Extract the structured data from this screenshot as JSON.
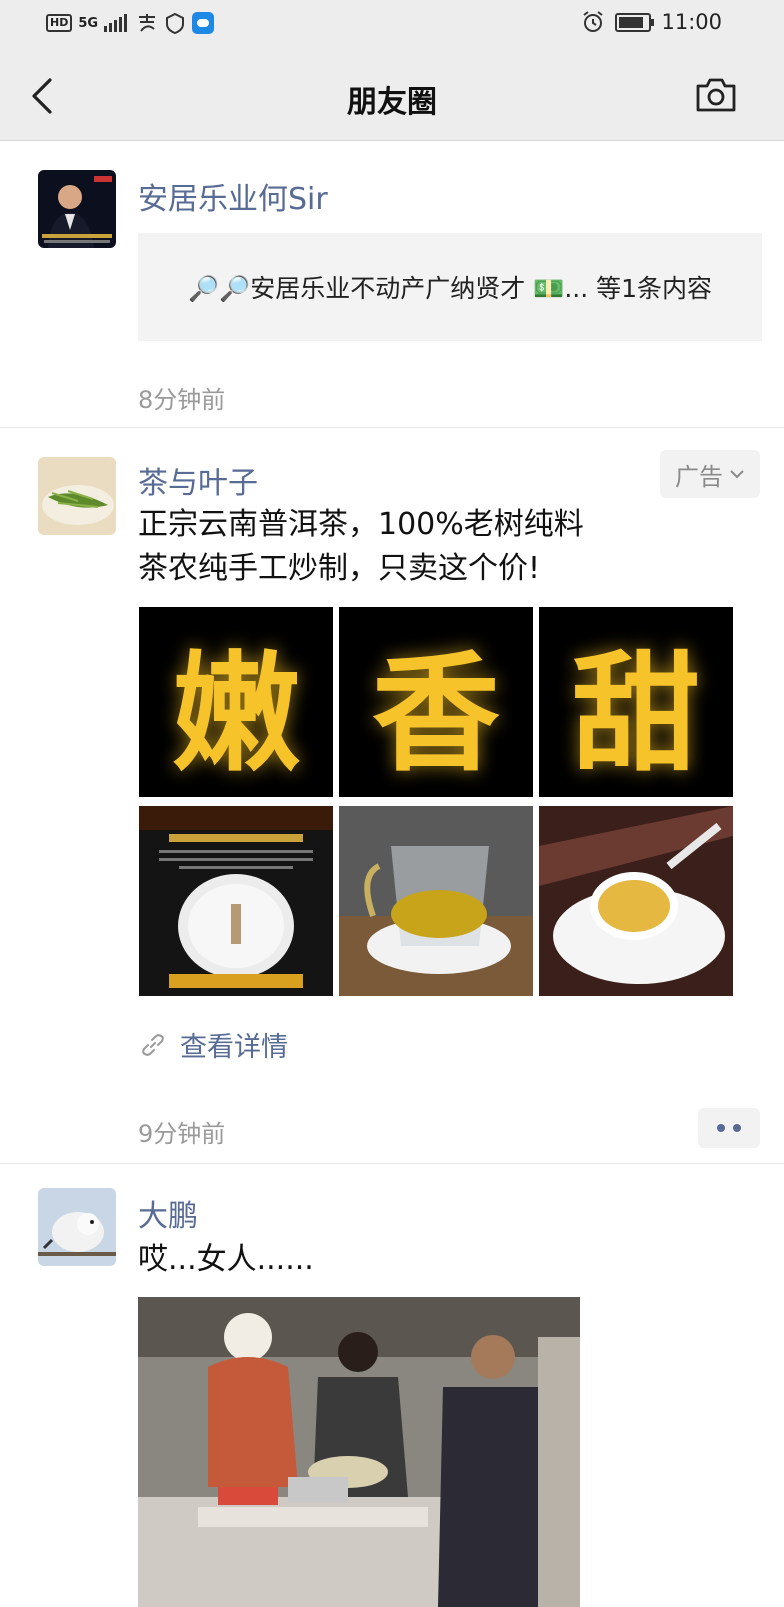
{
  "status_bar": {
    "network_badge": "HD",
    "network_type": "5G",
    "time": "11:00"
  },
  "nav": {
    "title": "朋友圈"
  },
  "posts": [
    {
      "author": "安居乐业何Sir",
      "share_text": "🔎🔎安居乐业不动产广纳贤才 💵... 等1条内容",
      "time": "8分钟前"
    },
    {
      "author": "茶与叶子",
      "ad_label": "广告",
      "text_line1": "正宗云南普洱茶，100%老树纯料",
      "text_line2": "茶农纯手工炒制，只卖这个价!",
      "grid_chars": [
        "嫩",
        "香",
        "甜"
      ],
      "link_text": "查看详情",
      "time": "9分钟前"
    },
    {
      "author": "大鹏",
      "text": "哎...女人......"
    }
  ],
  "colors": {
    "link_blue": "#576b95",
    "nav_bg": "#ededed",
    "time_gray": "#9a9a9a",
    "gold": "#f6c32a"
  }
}
